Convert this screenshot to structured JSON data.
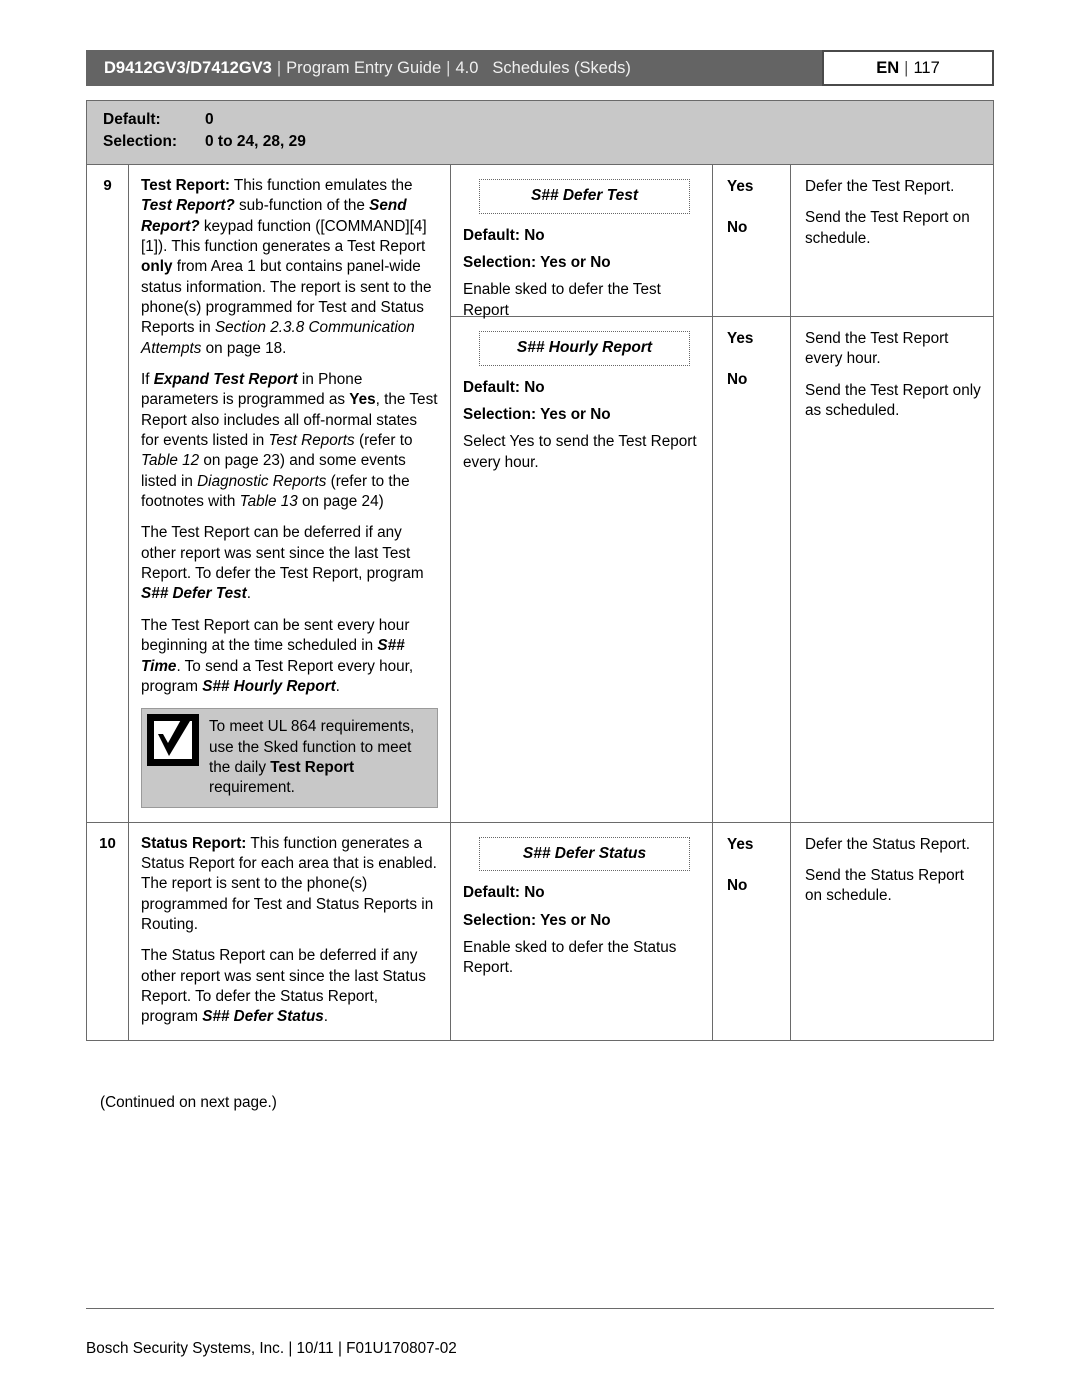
{
  "header": {
    "model": "D9412GV3/D7412GV3",
    "separator": "|",
    "guide": "Program Entry Guide",
    "version": "4.0",
    "section": "Schedules (Skeds)",
    "lang": "EN",
    "page_number": "117"
  },
  "defaults": {
    "default_label": "Default:",
    "default_value": "0",
    "selection_label": "Selection:",
    "selection_value": "0 to 24, 28, 29"
  },
  "rows": [
    {
      "number": "9",
      "description": {
        "p1_title": "Test Report:",
        "p1_a": " This function emulates the ",
        "p1_b": "Test Report?",
        "p1_c": " sub-function of the ",
        "p1_d": "Send Report?",
        "p1_e": " keypad function ([COMMAND][4][1]). This function generates a Test Report ",
        "p1_f": "only",
        "p1_g": " from Area 1 but contains panel-wide status information. The report is sent to the phone(s) programmed for Test and Status Reports in ",
        "p1_h": "Section 2.3.8 Communication Attempts",
        "p1_i": " on page 18.",
        "p2_a": "If ",
        "p2_b": "Expand Test Report",
        "p2_c": " in Phone parameters is programmed as ",
        "p2_d": "Yes",
        "p2_e": ", the Test Report also includes all off-normal states for events listed in ",
        "p2_f": "Test Reports",
        "p2_g": " (refer to ",
        "p2_h": "Table 12",
        "p2_i": " on page 23) and some events listed in ",
        "p2_j": "Diagnostic Reports",
        "p2_k": " (refer to the footnotes with ",
        "p2_l": "Table 13",
        "p2_m": " on page 24)",
        "p3_a": "The Test Report can be deferred if any other report was sent since the last Test Report. To defer the Test Report, program ",
        "p3_b": "S## Defer Test",
        "p3_c": ".",
        "p4_a": "The Test Report can be sent every hour beginning at the time scheduled in ",
        "p4_b": "S## Time",
        "p4_c": ". To send a Test Report every hour, program ",
        "p4_d": "S## Hourly Report",
        "p4_e": "."
      },
      "ul_note": {
        "icon": "checkmark-box-icon",
        "a": "To meet UL 864 requirements, use the Sked function to meet the daily ",
        "b": "Test Report",
        "c": " requirement."
      },
      "parameters": [
        {
          "name": "S## Defer Test",
          "default": "Default: No",
          "selection": "Selection: Yes or No",
          "note": "Enable sked to defer the Test Report",
          "choices": [
            {
              "value": "Yes",
              "action": "Defer the Test Report."
            },
            {
              "value": "No",
              "action": "Send the Test Report on schedule."
            }
          ]
        },
        {
          "name": "S## Hourly Report",
          "default": "Default: No",
          "selection": "Selection: Yes or No",
          "note": "Select Yes to send the Test Report every hour.",
          "choices": [
            {
              "value": "Yes",
              "action": "Send the Test Report every hour."
            },
            {
              "value": "No",
              "action": "Send the Test Report only as scheduled."
            }
          ]
        }
      ]
    },
    {
      "number": "10",
      "description": {
        "p1_title": "Status Report:",
        "p1_a": " This function generates a Status Report for each area that is enabled. The report is sent to the phone(s) programmed for Test and Status Reports in Routing.",
        "p2_a": "The Status Report can be deferred if any other report was sent since the last Status Report. To defer the Status Report, program ",
        "p2_b": "S## Defer Status",
        "p2_c": "."
      },
      "parameters": [
        {
          "name": "S## Defer Status",
          "default": "Default: No",
          "selection": "Selection: Yes or No",
          "note": "Enable sked to defer the Status Report.",
          "choices": [
            {
              "value": "Yes",
              "action": "Defer the Status Report."
            },
            {
              "value": "No",
              "action": "Send the Status Report on schedule."
            }
          ]
        }
      ]
    }
  ],
  "continued": "(Continued on next page.)",
  "footer": "Bosch Security Systems, Inc. | 10/11 | F01U170807-02",
  "colors": {
    "header_bar": "#646464",
    "band_gray": "#c8c8c8",
    "border": "#6a6a6a"
  }
}
